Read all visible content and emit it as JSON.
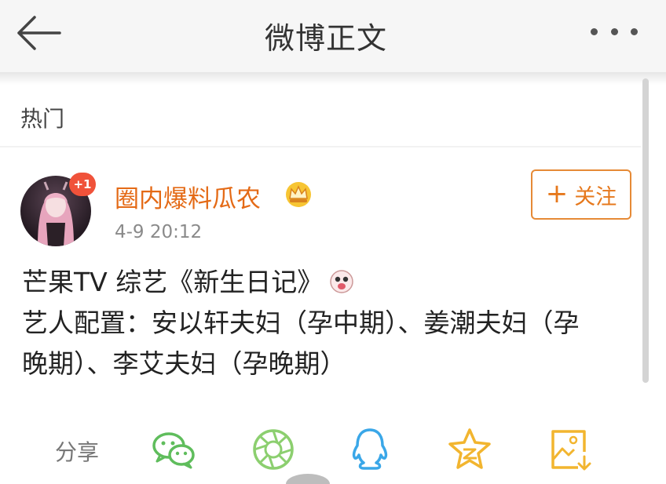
{
  "header": {
    "title": "微博正文",
    "back_icon": "back-arrow-icon",
    "more_icon": "more-dots-icon"
  },
  "section_label": "热门",
  "post": {
    "author": "圈内爆料瓜农",
    "badge": "+1",
    "verified_icon": "crown-icon",
    "timestamp": "4-9 20:12",
    "follow_label": "关注",
    "content_lines": [
      "芒果TV 综艺《新生日记》",
      "艺人配置：安以轩夫妇（孕中期）、姜潮夫妇（孕",
      "晚期）、李艾夫妇（孕晚期）"
    ]
  },
  "share": {
    "label": "分享",
    "targets": [
      "wechat-icon",
      "moments-icon",
      "qq-icon",
      "qzone-icon",
      "save-image-icon"
    ]
  },
  "colors": {
    "accent": "#e68a36",
    "username": "#e46a16",
    "wechat": "#5fbd5c",
    "qq": "#3aa7e8",
    "qzone": "#f2b52f"
  }
}
